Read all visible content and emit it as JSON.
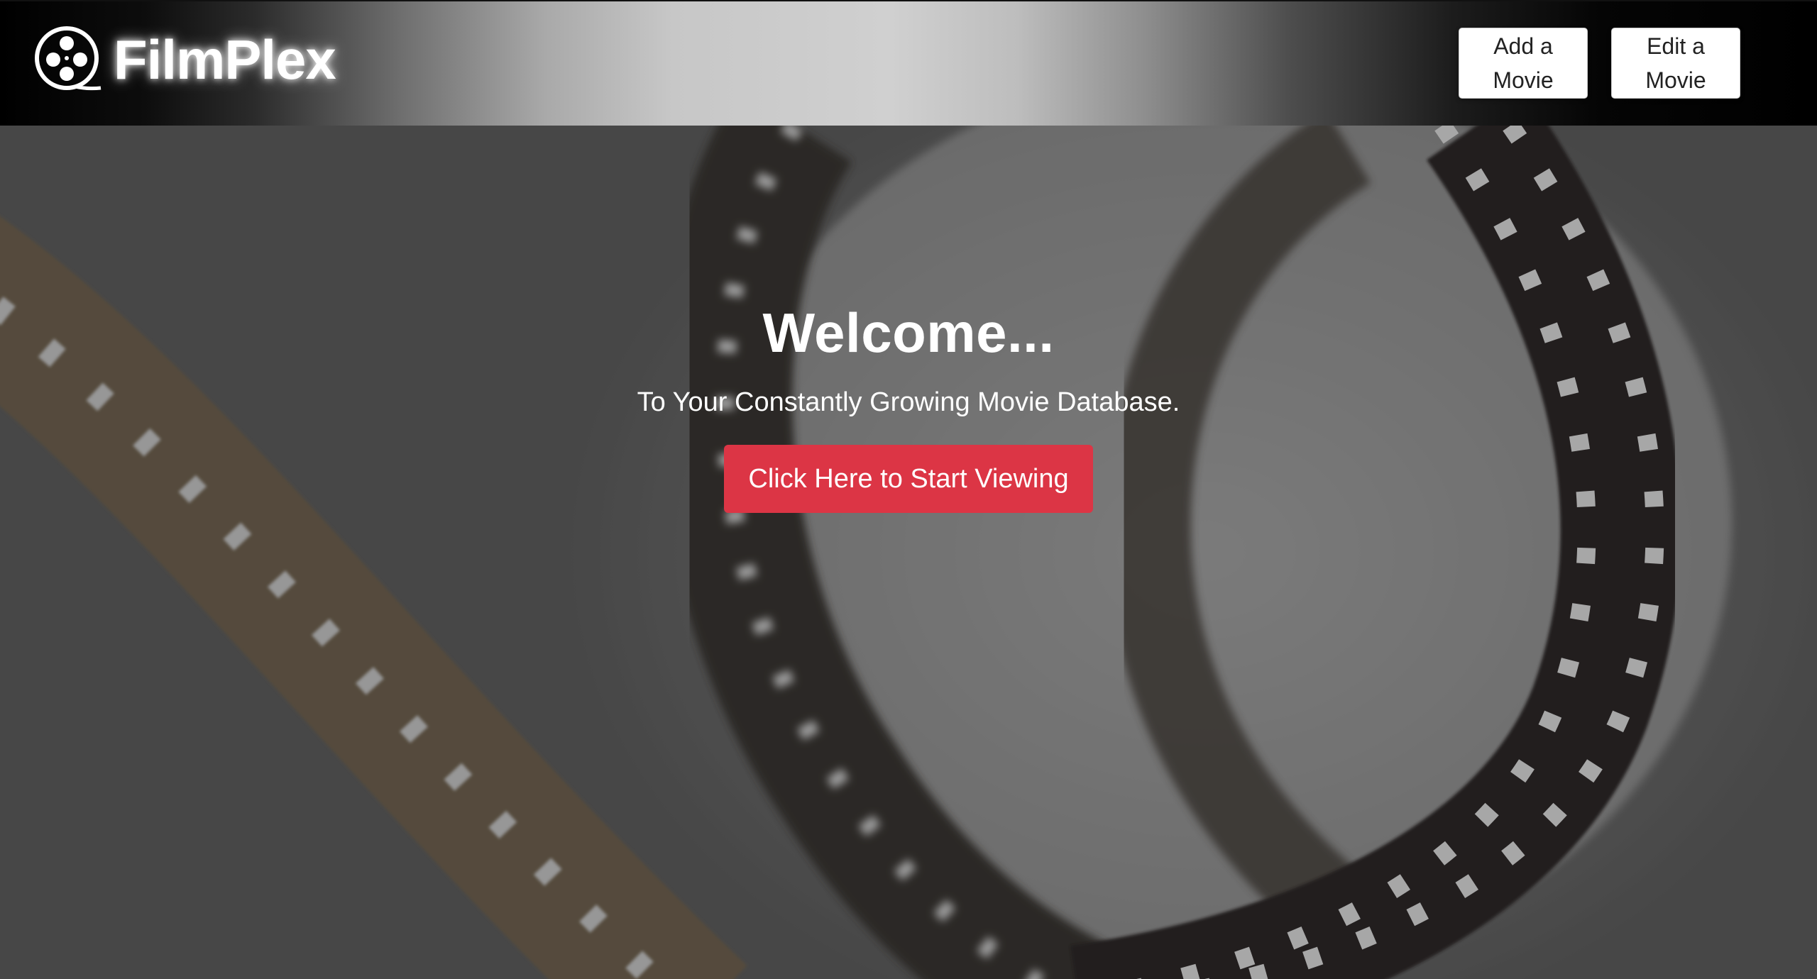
{
  "header": {
    "brand_name": "FilmPlex",
    "brand_icon": "film-reel-icon",
    "nav": {
      "add_label": "Add a Movie",
      "edit_label": "Edit a Movie"
    }
  },
  "hero": {
    "title": "Welcome...",
    "subtitle": "To Your Constantly Growing Movie Database.",
    "cta_label": "Click Here to Start Viewing",
    "background_image": "film-strip-photo"
  },
  "colors": {
    "cta": "#dc3545",
    "header_highlight": "#d0d0d0",
    "header_edge": "#000000"
  }
}
